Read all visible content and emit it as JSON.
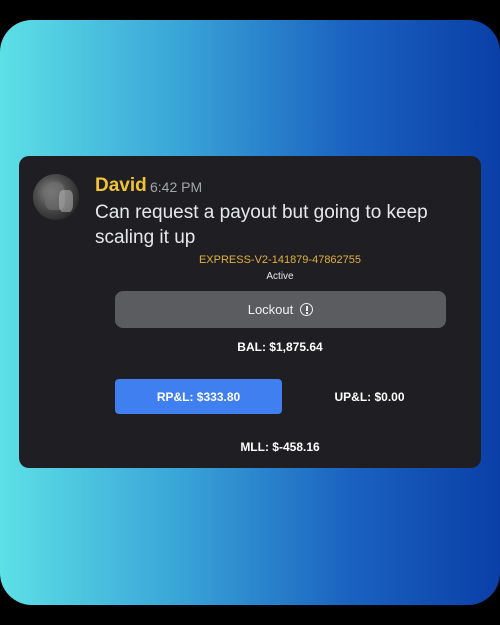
{
  "message": {
    "author": "David",
    "timestamp": "6:42 PM",
    "text": "Can request a payout but going to keep scaling it up"
  },
  "account": {
    "id": "EXPRESS-V2-141879-47862755",
    "status": "Active",
    "lockout_label": "Lockout",
    "balance": "BAL: $1,875.64",
    "realized_pnl": "RP&L: $333.80",
    "unrealized_pnl": "UP&L: $0.00",
    "mll": "MLL: $-458.16"
  },
  "colors": {
    "author": "#f1c232",
    "account_id": "#e0b03a",
    "rpl_button": "#3f7ff0",
    "lockout_button": "#5b5c60",
    "card_bg": "#1f1f23"
  },
  "icons": {
    "lockout": "info-circle-icon",
    "avatar": "user-avatar"
  }
}
